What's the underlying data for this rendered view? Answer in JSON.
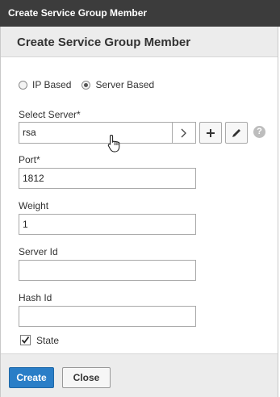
{
  "window": {
    "title": "Create Service Group Member"
  },
  "dialog": {
    "title": "Create Service Group Member",
    "radio_options": [
      {
        "label": "IP Based",
        "selected": false
      },
      {
        "label": "Server Based",
        "selected": true
      }
    ],
    "select_server": {
      "label": "Select Server*",
      "value": "rsa"
    },
    "port": {
      "label": "Port*",
      "value": "1812"
    },
    "weight": {
      "label": "Weight",
      "value": "1"
    },
    "server_id": {
      "label": "Server Id",
      "value": ""
    },
    "hash_id": {
      "label": "Hash Id",
      "value": ""
    },
    "state": {
      "label": "State",
      "checked": true
    },
    "help_symbol": "?"
  },
  "footer": {
    "create_label": "Create",
    "close_label": "Close"
  },
  "colors": {
    "titlebar": "#3c3c3c",
    "primary_button": "#2a7ec7",
    "header_bg": "#ececec"
  },
  "icons": [
    "chevron-right-icon",
    "plus-icon",
    "pencil-icon",
    "help-icon",
    "checkmark-icon",
    "hand-cursor-icon"
  ]
}
